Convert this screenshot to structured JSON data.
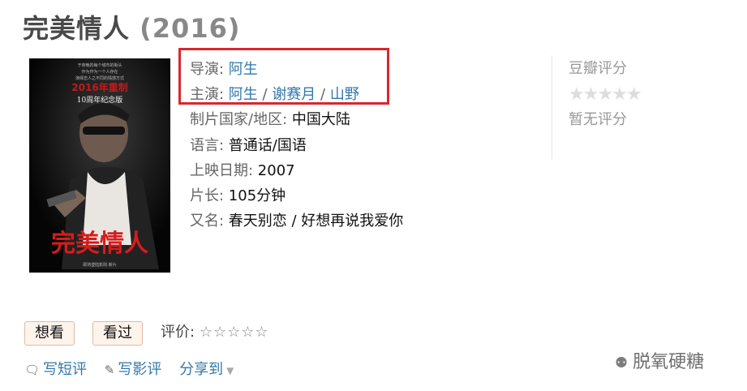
{
  "movie": {
    "title": "完美情人",
    "year": "(2016)"
  },
  "poster": {
    "top_text_lines": [
      "于夜晚的每个城市的街头",
      "作为作为一个人存在",
      "演绎恋人之不同的情感方式"
    ],
    "anniversary_line": "2016年重制",
    "edition": "10周年纪念版",
    "big_title": "完美情人",
    "bottom_text": "即将登陆影院·新片"
  },
  "info": {
    "director_label": "导演",
    "director": "阿生",
    "cast_label": "主演",
    "cast": [
      "阿生",
      "谢赛月",
      "山野"
    ],
    "country_label": "制片国家/地区",
    "country": "中国大陆",
    "language_label": "语言",
    "language": "普通话/国语",
    "release_label": "上映日期",
    "release": "2007",
    "runtime_label": "片长",
    "runtime": "105分钟",
    "aka_label": "又名",
    "aka": "春天别恋 / 好想再说我爱你"
  },
  "rating": {
    "title": "豆瓣评分",
    "stars": "★★★★★",
    "no_rating": "暂无评分"
  },
  "buttons": {
    "want": "想看",
    "seen": "看过"
  },
  "evaluate": {
    "label": "评价:",
    "stars": "☆☆☆☆☆"
  },
  "actions": {
    "short_review": "写短评",
    "review": "写影评",
    "share": "分享到",
    "caret": "▼"
  },
  "watermark": {
    "text": "脱氧硬糖"
  }
}
